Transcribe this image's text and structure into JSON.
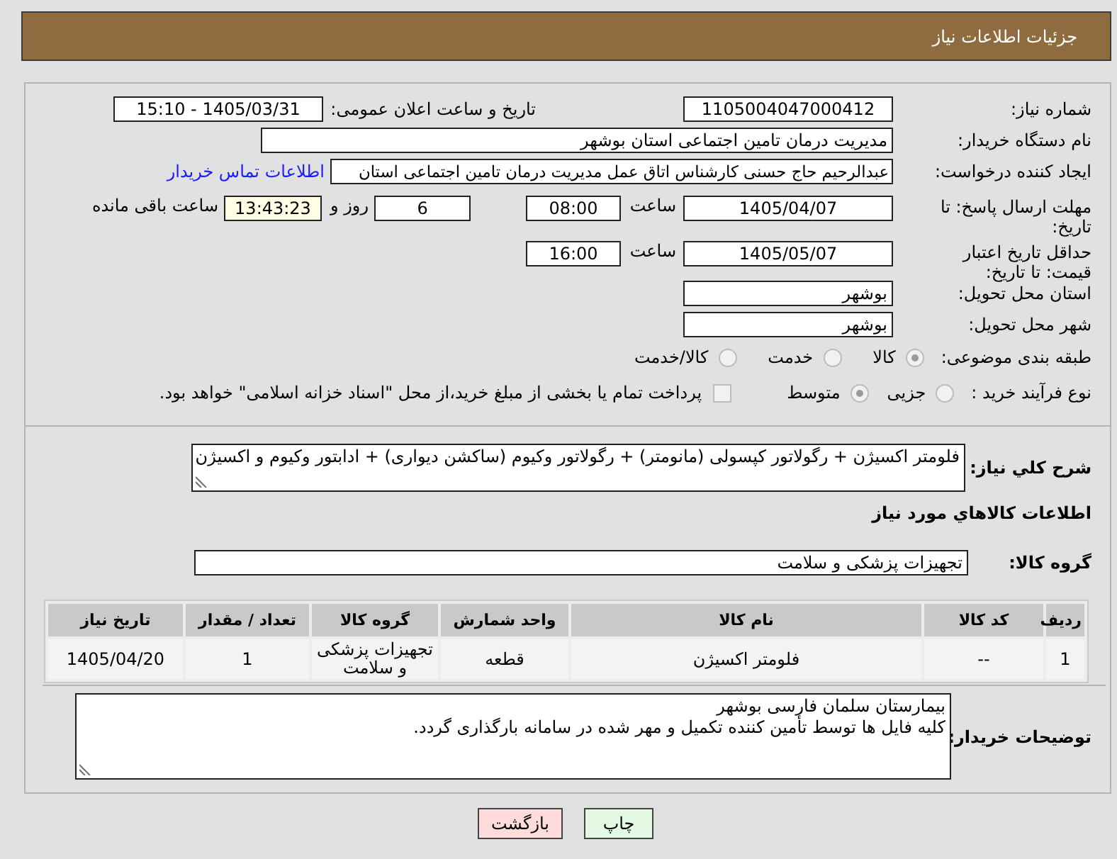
{
  "header": {
    "title": "جزئیات اطلاعات نیاز"
  },
  "need_number": {
    "label": "شماره نیاز:",
    "value": "1105004047000412"
  },
  "announce_datetime": {
    "label": "تاریخ و ساعت اعلان عمومی:",
    "value": "1405/03/31 - 15:10"
  },
  "buyer_org": {
    "label": "نام دستگاه خریدار:",
    "value": "مدیریت درمان تامین اجتماعی استان بوشهر"
  },
  "requester": {
    "label": "ایجاد کننده درخواست:",
    "value": "عبدالرحیم حاج حسنی کارشناس اتاق عمل مدیریت درمان تامین اجتماعی استان",
    "link": "اطلاعات تماس خریدار"
  },
  "reply_deadline": {
    "label": "مهلت ارسال پاسخ: تا تاریخ:",
    "date": "1405/04/07",
    "time_label": "ساعت",
    "time": "08:00",
    "days": "6",
    "days_label": "روز و",
    "remaining": "13:43:23",
    "remaining_label": "ساعت باقی مانده"
  },
  "price_validity": {
    "label": "حداقل تاریخ اعتبار قیمت: تا تاریخ:",
    "date": "1405/05/07",
    "time_label": "ساعت",
    "time": "16:00"
  },
  "delivery_province": {
    "label": "استان محل تحویل:",
    "value": "بوشهر"
  },
  "delivery_city": {
    "label": "شهر محل تحویل:",
    "value": "بوشهر"
  },
  "category": {
    "label": "طبقه بندی موضوعی:",
    "options": [
      {
        "label": "کالا",
        "selected": true
      },
      {
        "label": "خدمت",
        "selected": false
      },
      {
        "label": "کالا/خدمت",
        "selected": false
      }
    ]
  },
  "process_type": {
    "label": "نوع فرآیند خرید :",
    "options": [
      {
        "label": "جزیی",
        "selected": false
      },
      {
        "label": "متوسط",
        "selected": true
      }
    ],
    "treasury_payment": {
      "label": "پرداخت تمام یا بخشی از مبلغ خرید،از محل \"اسناد خزانه اسلامی\" خواهد بود.",
      "checked": false
    }
  },
  "description": {
    "label": "شرح کلي نیاز:",
    "value": "فلومتر اکسیژن + رگولاتور کپسولی (مانومتر) + رگولاتور وکیوم (ساکشن دیواری) + ادابتور وکیوم و اکسیژن"
  },
  "goods_section": {
    "title": "اطلاعات کالاهاي مورد نیاز"
  },
  "goods_group": {
    "label": "گروه کالا:",
    "value": "تجهیزات پزشکی و سلامت"
  },
  "goods_table": {
    "columns": [
      "ردیف",
      "کد کالا",
      "نام کالا",
      "واحد شمارش",
      "گروه کالا",
      "تعداد / مقدار",
      "تاریخ نیاز"
    ],
    "rows": [
      [
        "1",
        "--",
        "فلومتر اکسیژن",
        "قطعه",
        "تجهیزات پزشکی و سلامت",
        "1",
        "1405/04/20"
      ]
    ]
  },
  "buyer_notes": {
    "label": "توضیحات خریدار:",
    "lines": [
      "بیمارستان سلمان فارسی بوشهر",
      "کلیه فایل ها توسط تأمین کننده تکمیل و مهر شده در سامانه بارگذاری گردد."
    ]
  },
  "buttons": [
    {
      "label": "چاپ",
      "kind": "print"
    },
    {
      "label": "بازگشت",
      "kind": "back"
    }
  ]
}
